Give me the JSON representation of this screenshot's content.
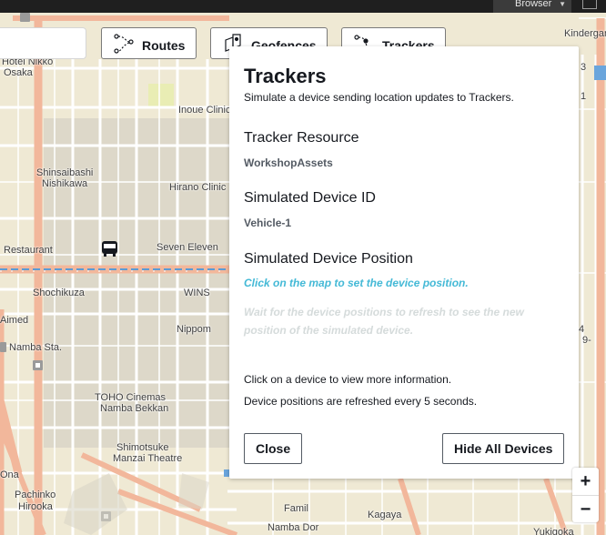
{
  "browser_bar": {
    "browser_label": "Browser"
  },
  "nav_tabs": [
    {
      "label": "Routes",
      "icon": "route-icon"
    },
    {
      "label": "Geofences",
      "icon": "geofence-icon"
    },
    {
      "label": "Trackers",
      "icon": "tracker-icon"
    }
  ],
  "map": {
    "labels": [
      "Kindergarter",
      "Hotel Nikko",
      "Osaka",
      "Inoue Clinic",
      "Shinsaibashi",
      "Nishikawa",
      "Hirano Clinic",
      "Seven Eleven",
      "Restaurant",
      "Shochikuza",
      "WINS",
      "Nippom",
      "Namba Sta.",
      "TOHO Cinemas",
      "Namba Bekkan",
      "Shimotsuke",
      "Manzai Theatre",
      "Pachinko",
      "Hirooka",
      "Yukigoka",
      "Kagaya",
      "Namba Dor",
      "Aimed",
      "Ona",
      "Famil",
      "4",
      "3",
      "1",
      "9-"
    ],
    "vehicle_icon": "bus-icon"
  },
  "panel": {
    "title": "Trackers",
    "subtitle": "Simulate a device sending location updates to Trackers.",
    "tracker_resource_heading": "Tracker Resource",
    "tracker_resource_value": "WorkshopAssets",
    "device_id_heading": "Simulated Device ID",
    "device_id_value": "Vehicle-1",
    "device_position_heading": "Simulated Device Position",
    "position_hint": "Click on the map to set the device position.",
    "wait_hint": "Wait for the device positions to refresh to see the new position of the simulated device.",
    "info_click": "Click on a device to view more information.",
    "info_refresh": "Device positions are refreshed every 5 seconds.",
    "close_button": "Close",
    "hide_button": "Hide All Devices"
  },
  "zoom": {
    "zoom_in": "+",
    "zoom_out": "−"
  },
  "colors": {
    "map_background": "#efe9d4",
    "major_road": "#f2b79b",
    "minor_road": "#ffffff",
    "block": "#d9d5c7",
    "rail": "#5b9bd5",
    "hint_link": "#44b9d6",
    "hint_muted": "#d5dbdb"
  }
}
